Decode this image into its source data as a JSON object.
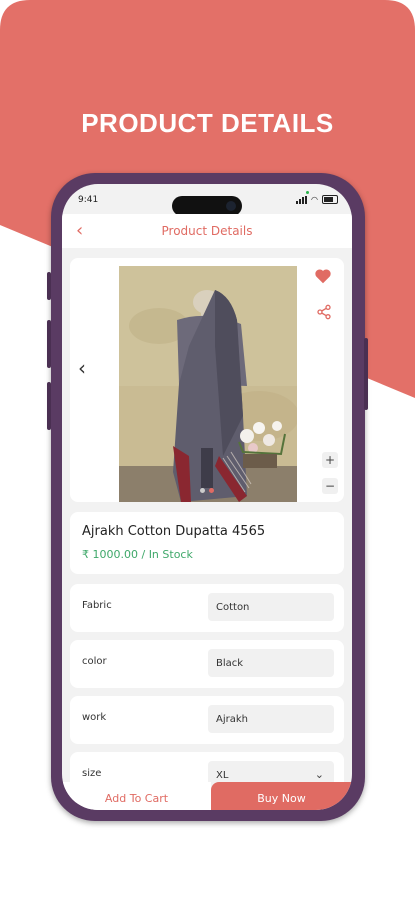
{
  "hero": {
    "title": "PRODUCT DETAILS"
  },
  "colors": {
    "accent": "#e06b63",
    "price": "#3fa86a",
    "frame": "#5a3b63"
  },
  "status": {
    "time": "9:41"
  },
  "header": {
    "title": "Product Details",
    "back_icon": "chevron-left-icon"
  },
  "gallery": {
    "prev_icon": "chevron-left-icon",
    "favorite_icon": "heart-icon",
    "share_icon": "share-icon",
    "zoom_in": "+",
    "zoom_out": "−"
  },
  "product": {
    "name": "Ajrakh Cotton Dupatta 4565",
    "price": "₹ 1000.00",
    "separator": " / ",
    "stock": "In Stock"
  },
  "attributes": [
    {
      "label": "Fabric",
      "value": "Cotton"
    },
    {
      "label": "color",
      "value": "Black"
    },
    {
      "label": "work",
      "value": "Ajrakh"
    },
    {
      "label": "size",
      "value": "XL"
    }
  ],
  "actions": {
    "add_to_cart": "Add To Cart",
    "buy_now": "Buy Now"
  }
}
